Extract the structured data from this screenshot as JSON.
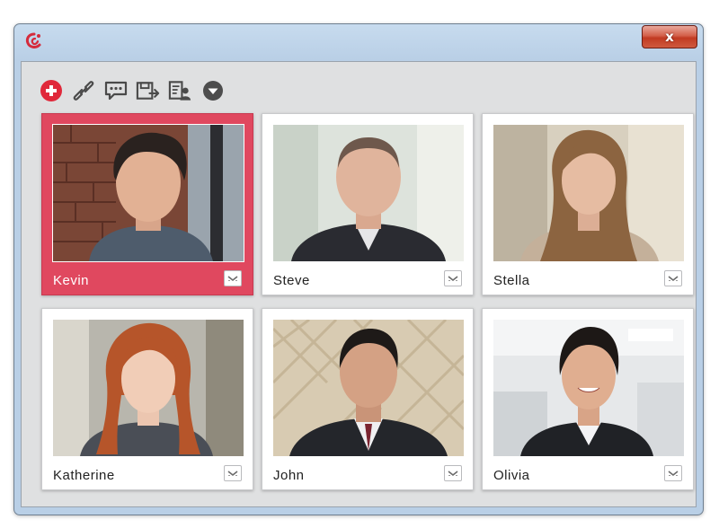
{
  "window": {
    "close_label": "x"
  },
  "toolbar": {
    "buttons": [
      {
        "icon": "add-icon"
      },
      {
        "icon": "link-icon"
      },
      {
        "icon": "chat-icon"
      },
      {
        "icon": "export-icon"
      },
      {
        "icon": "contact-card-icon"
      },
      {
        "icon": "dropdown-icon"
      }
    ]
  },
  "participants": [
    {
      "name": "Kevin",
      "selected": true
    },
    {
      "name": "Steve",
      "selected": false
    },
    {
      "name": "Stella",
      "selected": false
    },
    {
      "name": "Katherine",
      "selected": false
    },
    {
      "name": "John",
      "selected": false
    },
    {
      "name": "Olivia",
      "selected": false
    }
  ],
  "colors": {
    "selected_tile": "#e0485f",
    "accent_red": "#e0283a",
    "toolbar_icon": "#4a4a4a"
  }
}
